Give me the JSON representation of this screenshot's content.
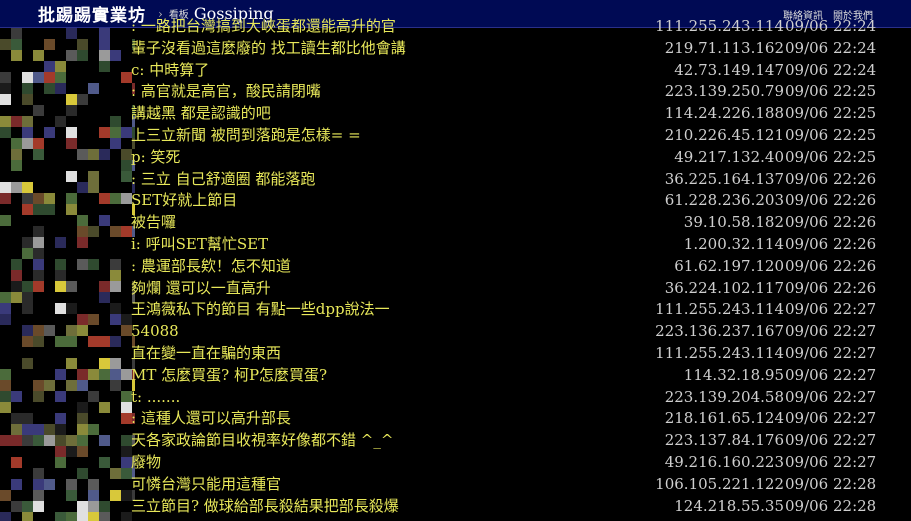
{
  "header": {
    "brand": "批踢踢實業坊",
    "board_label": "看板",
    "board_name": "Gossiping",
    "links": [
      "聯絡資訊",
      "關於我們"
    ]
  },
  "pushes": [
    {
      "content": ": 一路把台灣搞到大峽蛋都還能高升的官",
      "ip": "111.255.243.114",
      "time": "09/06 22:24"
    },
    {
      "content": "輩子沒看過這麼廢的 找工讀生都比他會講",
      "ip": "219.71.113.162",
      "time": "09/06 22:24"
    },
    {
      "content": "c: 中時算了",
      "ip": "42.73.149.147",
      "time": "09/06 22:24"
    },
    {
      "content": ": 高官就是高官，酸民請閉嘴",
      "ip": "223.139.250.79",
      "time": "09/06 22:25"
    },
    {
      "content": "講越黑 都是認識的吧",
      "ip": "114.24.226.188",
      "time": "09/06 22:25"
    },
    {
      "content": "上三立新聞 被問到落跑是怎樣= =",
      "ip": "210.226.45.121",
      "time": "09/06 22:25"
    },
    {
      "content": "p: 笑死",
      "ip": "49.217.132.40",
      "time": "09/06 22:25"
    },
    {
      "content": ": 三立 自己舒適圈 都能落跑",
      "ip": "36.225.164.137",
      "time": "09/06 22:26"
    },
    {
      "content": "SET好就上節目",
      "ip": "61.228.236.203",
      "time": "09/06 22:26"
    },
    {
      "content": "被告囉",
      "ip": "39.10.58.182",
      "time": "09/06 22:26"
    },
    {
      "content": "i: 呼叫SET幫忙SET",
      "ip": "1.200.32.114",
      "time": "09/06 22:26"
    },
    {
      "content": ": 農運部長欸！怎不知道",
      "ip": "61.62.197.120",
      "time": "09/06 22:26"
    },
    {
      "content": "夠爛 還可以一直高升",
      "ip": "36.224.102.117",
      "time": "09/06 22:26"
    },
    {
      "content": "王鴻薇私下的節目 有點一些dpp說法一",
      "ip": "111.255.243.114",
      "time": "09/06 22:27"
    },
    {
      "content": " 54088",
      "ip": "223.136.237.167",
      "time": "09/06 22:27"
    },
    {
      "content": "直在變一直在騙的東西",
      "ip": "111.255.243.114",
      "time": "09/06 22:27"
    },
    {
      "content": "MT 怎麼買蛋?  柯P怎麼買蛋?",
      "ip": "114.32.18.95",
      "time": "09/06 22:27"
    },
    {
      "content": "  t: .......",
      "ip": "223.139.204.58",
      "time": "09/06 22:27"
    },
    {
      "content": ": 這種人還可以高升部長",
      "ip": "218.161.65.124",
      "time": "09/06 22:27"
    },
    {
      "content": "天各家政論節目收視率好像都不錯 ^_^",
      "ip": "223.137.84.176",
      "time": "09/06 22:27"
    },
    {
      "content": "廢物",
      "ip": "49.216.160.223",
      "time": "09/06 22:27"
    },
    {
      "content": "可憐台灣只能用這種官",
      "ip": "106.105.221.122",
      "time": "09/06 22:28"
    },
    {
      "content": "三立節目? 做球給部長殺結果把部長殺爆",
      "ip": "124.218.55.35",
      "time": "09/06 22:28"
    }
  ]
}
